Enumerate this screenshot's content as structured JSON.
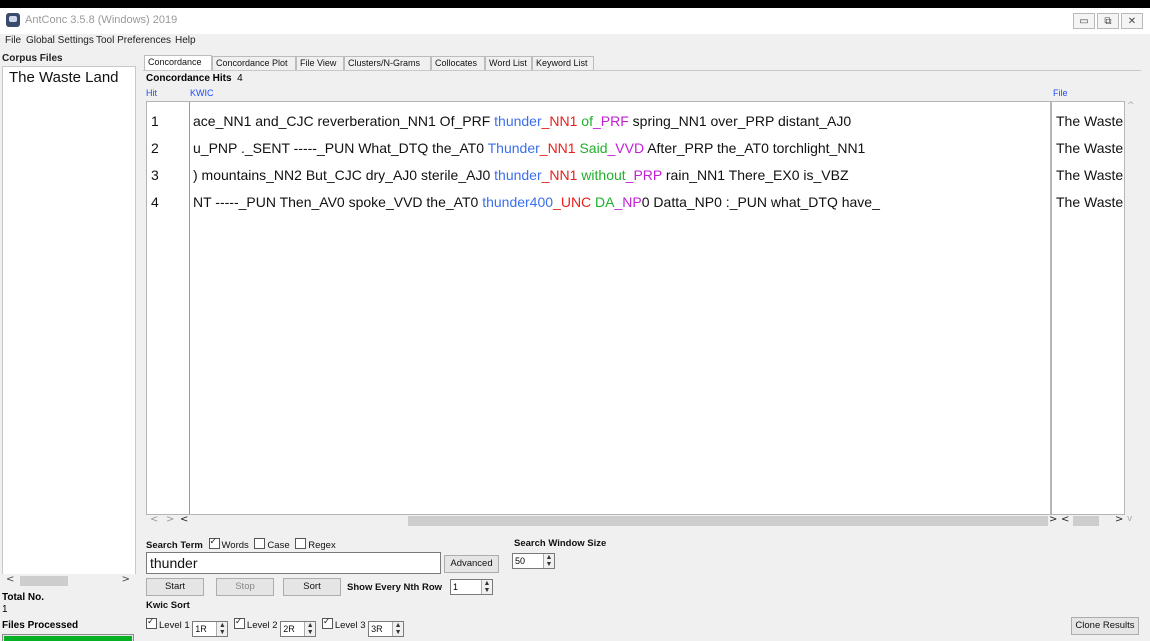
{
  "window": {
    "title": "AntConc 3.5.8 (Windows) 2019"
  },
  "menu": [
    "File",
    "Global Settings",
    "Tool Preferences",
    "Help"
  ],
  "sidebar": {
    "heading": "Corpus Files",
    "files": [
      "The Waste Land"
    ],
    "total_label": "Total No.",
    "total_value": "1",
    "files_processed_label": "Files Processed",
    "progress": 1.0
  },
  "tabs": [
    "Concordance",
    "Concordance Plot",
    "File View",
    "Clusters/N-Grams",
    "Collocates",
    "Word List",
    "Keyword List"
  ],
  "active_tab": "Concordance",
  "concordance": {
    "hits_label": "Concordance Hits",
    "hits_value": "4",
    "col_hit": "Hit",
    "col_kwic": "KWIC",
    "col_file": "File",
    "rows": [
      {
        "hit": "1",
        "left": "ace_NN1  and_CJC reverberation_NN1 Of_PRF ",
        "kw": "thunder",
        "t1": "_NN1",
        "w2": " of",
        "t2": "_PRF",
        "right": " spring_NN1 over_PRP  distant_AJ0",
        "file": "The Waste Land"
      },
      {
        "hit": "2",
        "left": "u_PNP  ._SENT -----_PUN  What_DTQ the_AT0 ",
        "kw": "Thunder",
        "t1": "_NN1",
        "w2": " Said",
        "t2": "_VVD",
        "right": " After_PRP the_AT0 torchlight_NN1",
        "file": "The Waste Land"
      },
      {
        "hit": "3",
        "left": ") mountains_NN2 But_CJC  dry_AJ0 sterile_AJ0 ",
        "kw": "thunder",
        "t1": "_NN1",
        "w2": " without",
        "t2": "_PRP",
        "right": " rain_NN1 There_EX0 is_VBZ",
        "file": "The Waste Land"
      },
      {
        "hit": "4",
        "left": "NT  -----_PUN  Then_AV0 spoke_VVD the_AT0 ",
        "kw": "thunder400",
        "t1": "_UNC",
        "w2": " DA",
        "t2": "_NP",
        "right": "0 Datta_NP0 :_PUN what_DTQ  have_",
        "file": "The Waste Land"
      }
    ]
  },
  "search": {
    "term_label": "Search Term",
    "words_label": "Words",
    "words_checked": true,
    "case_label": "Case",
    "case_checked": false,
    "regex_label": "Regex",
    "regex_checked": false,
    "value": "thunder",
    "advanced_label": "Advanced",
    "window_size_label": "Search Window Size",
    "window_size_value": "50",
    "start_label": "Start",
    "stop_label": "Stop",
    "sort_label": "Sort",
    "nth_row_label": "Show Every Nth Row",
    "nth_row_value": "1"
  },
  "kwic_sort": {
    "label": "Kwic Sort",
    "levels": [
      {
        "label": "Level 1",
        "value": "1R",
        "checked": true
      },
      {
        "label": "Level 2",
        "value": "2R",
        "checked": true
      },
      {
        "label": "Level 3",
        "value": "3R",
        "checked": true
      }
    ]
  },
  "clone_results_label": "Clone Results",
  "colors": {
    "keyword": "#3b6ff0",
    "tag1": "#e8201c",
    "word2": "#21b02a",
    "tag2": "#c21fd6"
  }
}
